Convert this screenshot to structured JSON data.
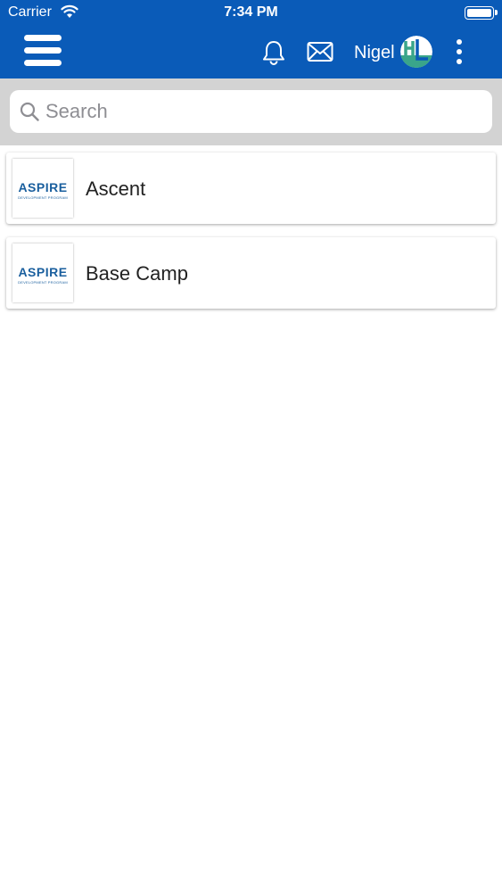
{
  "status_bar": {
    "carrier": "Carrier",
    "time": "7:34 PM"
  },
  "nav_bar": {
    "background": "#0a5bb8",
    "icons": {
      "menu": "hamburger-menu-icon",
      "notifications": "bell-icon",
      "messages": "mail-icon",
      "more": "kebab-icon"
    },
    "user": {
      "name": "Nigel",
      "avatar_initials": "HL"
    }
  },
  "search": {
    "placeholder": "Search",
    "value": ""
  },
  "programs": [
    {
      "logo_text": "ASPIRE",
      "logo_subtext": "DEVELOPMENT PROGRAM",
      "title": "Ascent"
    },
    {
      "logo_text": "ASPIRE",
      "logo_subtext": "DEVELOPMENT PROGRAM",
      "title": "Base Camp"
    }
  ],
  "colors": {
    "primary": "#0a5bb8",
    "search_bg": "#d3d3d3",
    "logo": "#1a5f9e",
    "avatar_teal": "#3aa58a"
  }
}
